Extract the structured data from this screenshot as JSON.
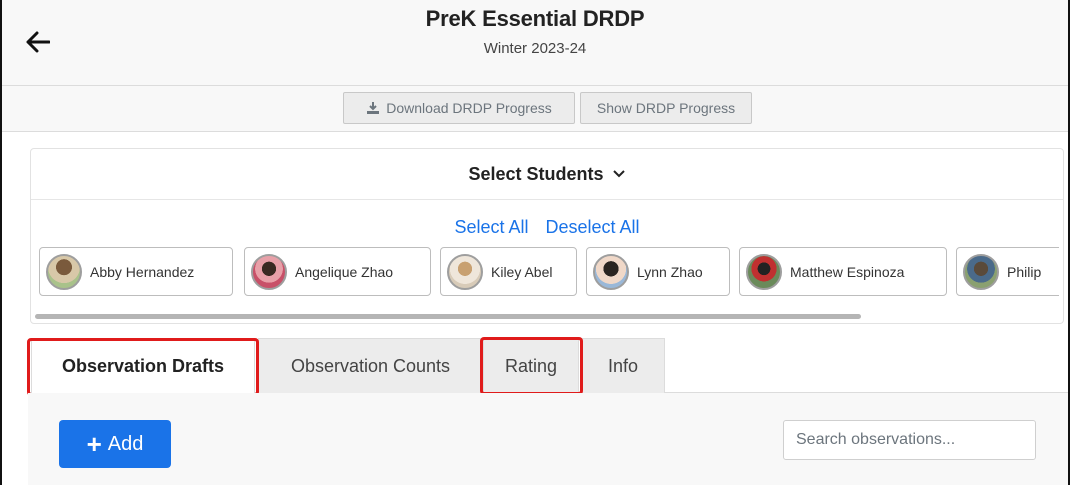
{
  "header": {
    "title": "PreK Essential DRDP",
    "subtitle": "Winter 2023-24"
  },
  "toolbar": {
    "download_label": "Download DRDP Progress",
    "show_label": "Show DRDP Progress"
  },
  "students_panel": {
    "title": "Select Students",
    "select_all": "Select All",
    "deselect_all": "Deselect All",
    "students": [
      {
        "name": "Abby Hernandez"
      },
      {
        "name": "Angelique Zhao"
      },
      {
        "name": "Kiley Abel"
      },
      {
        "name": "Lynn Zhao"
      },
      {
        "name": "Matthew Espinoza"
      },
      {
        "name": "Philip"
      }
    ]
  },
  "tabs": [
    {
      "label": "Observation Drafts",
      "active": true
    },
    {
      "label": "Observation Counts",
      "active": false
    },
    {
      "label": "Rating",
      "active": false
    },
    {
      "label": "Info",
      "active": false
    }
  ],
  "actions": {
    "add_label": "Add",
    "search_placeholder": "Search observations..."
  },
  "colors": {
    "accent": "#1a73e8",
    "highlight": "#e01b1b"
  }
}
